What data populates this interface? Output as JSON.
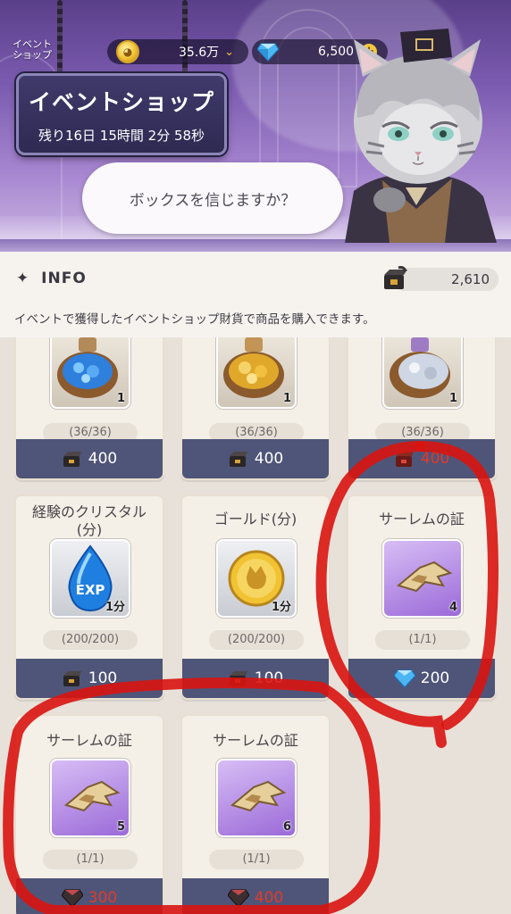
{
  "header": {
    "corner_label_line1": "イベント",
    "corner_label_line2": "ショップ",
    "title": "イベントショップ",
    "timer": "残り16日 15時間 2分 58秒",
    "gold": "35.6万",
    "gems": "6,500",
    "speech": "ボックスを信じますか？"
  },
  "info": {
    "heading": "INFO",
    "description": "イベントで獲得したイベントショップ財貨で商品を購入できます。",
    "balance": "2,610"
  },
  "items": [
    {
      "name": "",
      "qty": "1",
      "stock": "(36/36)",
      "price": "400",
      "currency": "event-box",
      "theme": "blue-gems"
    },
    {
      "name": "",
      "qty": "1",
      "stock": "(36/36)",
      "price": "400",
      "currency": "event-box",
      "theme": "gold-coins"
    },
    {
      "name": "",
      "qty": "1",
      "stock": "(36/36)",
      "price": "400",
      "currency": "event-box-red",
      "theme": "silver"
    },
    {
      "name": "経験のクリスタル(分)",
      "qty": "1分",
      "stock": "(200/200)",
      "price": "100",
      "currency": "event-box",
      "theme": "exp"
    },
    {
      "name": "ゴールド(分)",
      "qty": "1分",
      "stock": "(200/200)",
      "price": "100",
      "currency": "event-box",
      "theme": "gold"
    },
    {
      "name": "サーレムの証",
      "qty": "4",
      "stock": "(1/1)",
      "price": "200",
      "currency": "gem",
      "theme": "emblem"
    },
    {
      "name": "サーレムの証",
      "qty": "5",
      "stock": "(1/1)",
      "price": "300",
      "currency": "red-gem",
      "theme": "emblem"
    },
    {
      "name": "サーレムの証",
      "qty": "6",
      "stock": "(1/1)",
      "price": "400",
      "currency": "red-gem",
      "theme": "emblem"
    }
  ],
  "exp_label": "EXP",
  "colors": {
    "price_bar": "#4f5578",
    "annotation_red": "#d9140f",
    "insufficient_price": "#e23a2a"
  }
}
